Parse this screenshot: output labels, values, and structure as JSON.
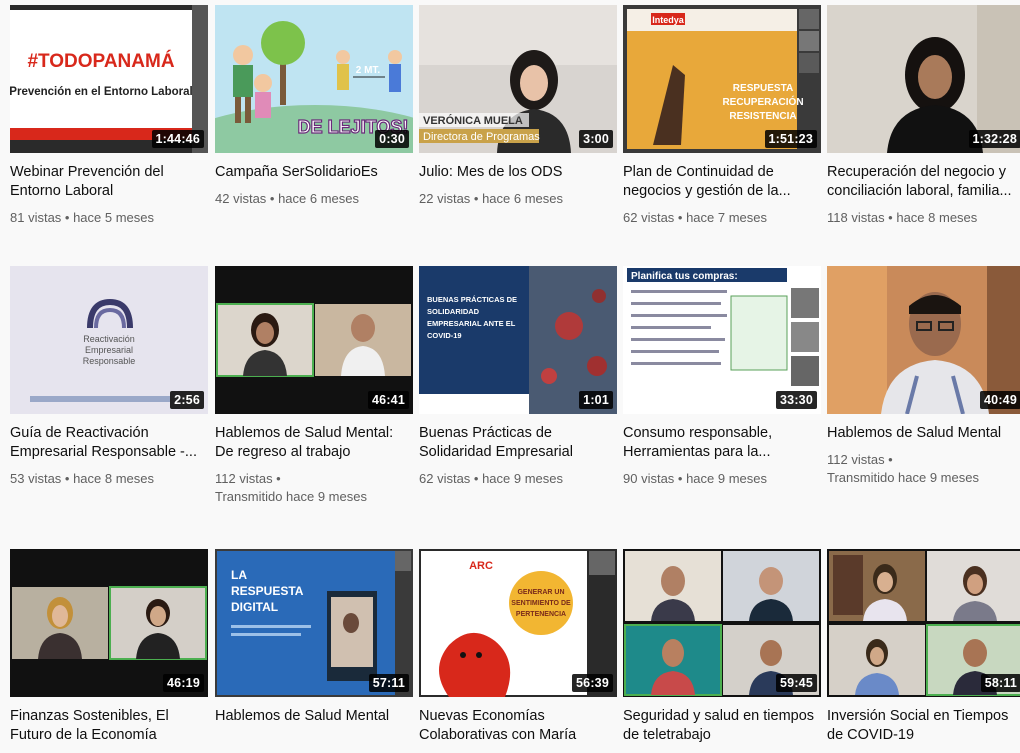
{
  "videos": [
    {
      "title": "Webinar Prevención del Entorno Laboral",
      "duration": "1:44:46",
      "meta1": "81 vistas • hace 5 meses",
      "meta2": "",
      "thumb_text": [
        "#TODOPANAMÁ",
        "Prevención en el Entorno Laboral"
      ]
    },
    {
      "title": "Campaña SerSolidarioEs",
      "duration": "0:30",
      "meta1": "42 vistas • hace 6 meses",
      "meta2": "",
      "thumb_text": [
        "2 MT.",
        "DE LEJITOS!"
      ]
    },
    {
      "title": "Julio: Mes de los ODS",
      "duration": "3:00",
      "meta1": "22 vistas • hace 6 meses",
      "meta2": "",
      "thumb_text": [
        "VERÓNICA MUELA",
        "Directora de Programas"
      ]
    },
    {
      "title": "Plan de Continuidad de negocios y gestión de la...",
      "duration": "1:51:23",
      "meta1": "62 vistas • hace 7 meses",
      "meta2": "",
      "thumb_text": [
        "Intedya",
        "RESPUESTA",
        "RECUPERACIÓN",
        "RESISTENCIA"
      ]
    },
    {
      "title": "Recuperación del negocio y conciliación laboral, familia...",
      "duration": "1:32:28",
      "meta1": "118 vistas • hace 8 meses",
      "meta2": "",
      "thumb_text": []
    },
    {
      "title": "Guía de Reactivación Empresarial Responsable -...",
      "duration": "2:56",
      "meta1": "53 vistas • hace 8 meses",
      "meta2": "",
      "thumb_text": [
        "Reactivación",
        "Empresarial",
        "Responsable"
      ]
    },
    {
      "title": "Hablemos de Salud Mental: De regreso al trabajo",
      "duration": "46:41",
      "meta1": "112 vistas •",
      "meta2": "Transmitido hace 9 meses",
      "thumb_text": []
    },
    {
      "title": "Buenas Prácticas de Solidaridad Empresarial",
      "duration": "1:01",
      "meta1": "62 vistas • hace 9 meses",
      "meta2": "",
      "thumb_text": [
        "BUENAS PRÁCTICAS DE",
        "SOLIDARIDAD",
        "EMPRESARIAL ANTE EL",
        "COVID-19"
      ]
    },
    {
      "title": "Consumo responsable, Herramientas para la...",
      "duration": "33:30",
      "meta1": "90 vistas • hace 9 meses",
      "meta2": "",
      "thumb_text": [
        "Planifica tus compras:"
      ]
    },
    {
      "title": "Hablemos de Salud Mental",
      "duration": "40:49",
      "meta1": "112 vistas •",
      "meta2": "Transmitido hace 9 meses",
      "thumb_text": []
    },
    {
      "title": "Finanzas Sostenibles, El Futuro de la Economía",
      "duration": "46:19",
      "meta1": "",
      "meta2": "",
      "thumb_text": []
    },
    {
      "title": "Hablemos de Salud Mental",
      "duration": "57:11",
      "meta1": "",
      "meta2": "",
      "thumb_text": [
        "LA",
        "RESPUESTA",
        "DIGITAL"
      ]
    },
    {
      "title": "Nuevas Economías Colaborativas con María",
      "duration": "56:39",
      "meta1": "",
      "meta2": "",
      "thumb_text": [
        "GENERAR UN",
        "SENTIMIENTO DE",
        "PERTENENCIA"
      ]
    },
    {
      "title": "Seguridad y salud en tiempos de teletrabajo",
      "duration": "59:45",
      "meta1": "",
      "meta2": "",
      "thumb_text": []
    },
    {
      "title": "Inversión Social en Tiempos de COVID-19",
      "duration": "58:11",
      "meta1": "",
      "meta2": "",
      "thumb_text": []
    }
  ],
  "colors": {
    "duration_bg": "#000000",
    "meta": "#606060",
    "title": "#0f0f0f",
    "accent_red": "#e62117"
  }
}
